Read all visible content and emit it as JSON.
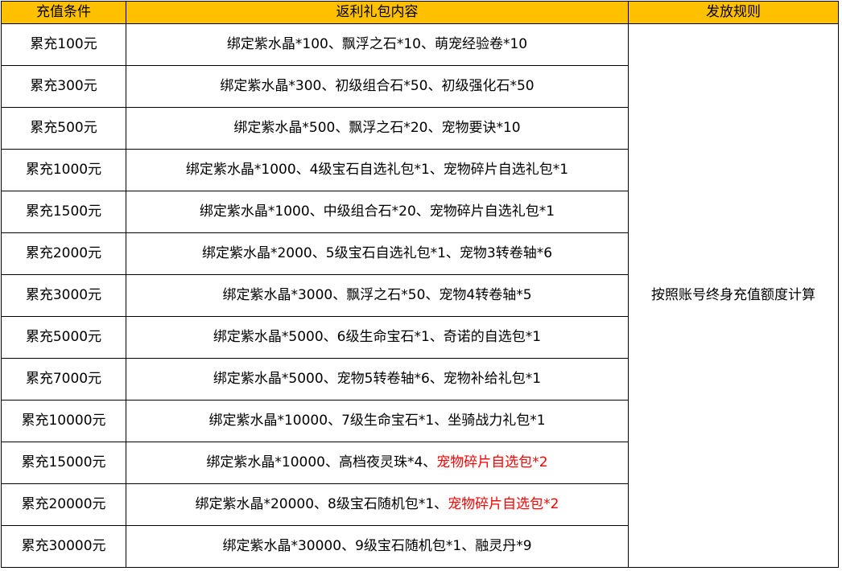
{
  "headers": {
    "condition": "充值条件",
    "content": "返利礼包内容",
    "rule": "发放规则"
  },
  "rule_text": "按照账号终身充值额度计算",
  "highlight_color": "#ff0000",
  "header_color": "#ffc000",
  "rows": [
    {
      "condition": "累充100元",
      "content": "绑定紫水晶*100、飘浮之石*10、萌宠经验卷*10",
      "highlight": ""
    },
    {
      "condition": "累充300元",
      "content": "绑定紫水晶*300、初级组合石*50、初级强化石*50",
      "highlight": ""
    },
    {
      "condition": "累充500元",
      "content": "绑定紫水晶*500、飘浮之石*20、宠物要诀*10",
      "highlight": ""
    },
    {
      "condition": "累充1000元",
      "content": "绑定紫水晶*1000、4级宝石自选礼包*1、宠物碎片自选礼包*1",
      "highlight": ""
    },
    {
      "condition": "累充1500元",
      "content": "绑定紫水晶*1000、中级组合石*20、宠物碎片自选礼包*1",
      "highlight": ""
    },
    {
      "condition": "累充2000元",
      "content": "绑定紫水晶*2000、5级宝石自选礼包*1、宠物3转卷轴*6",
      "highlight": ""
    },
    {
      "condition": "累充3000元",
      "content": "绑定紫水晶*3000、飘浮之石*50、宠物4转卷轴*5",
      "highlight": ""
    },
    {
      "condition": "累充5000元",
      "content": "绑定紫水晶*5000、6级生命宝石*1、奇诺的自选包*1",
      "highlight": ""
    },
    {
      "condition": "累充7000元",
      "content": "绑定紫水晶*5000、宠物5转卷轴*6、宠物补给礼包*1",
      "highlight": ""
    },
    {
      "condition": "累充10000元",
      "content": "绑定紫水晶*10000、7级生命宝石*1、坐骑战力礼包*1",
      "highlight": ""
    },
    {
      "condition": "累充15000元",
      "content": "绑定紫水晶*10000、高档夜灵珠*4、",
      "highlight": "宠物碎片自选包*2"
    },
    {
      "condition": "累充20000元",
      "content": "绑定紫水晶*20000、8级宝石随机包*1、",
      "highlight": "宠物碎片自选包*2"
    },
    {
      "condition": "累充30000元",
      "content": "绑定紫水晶*30000、9级宝石随机包*1、融灵丹*9",
      "highlight": ""
    }
  ]
}
